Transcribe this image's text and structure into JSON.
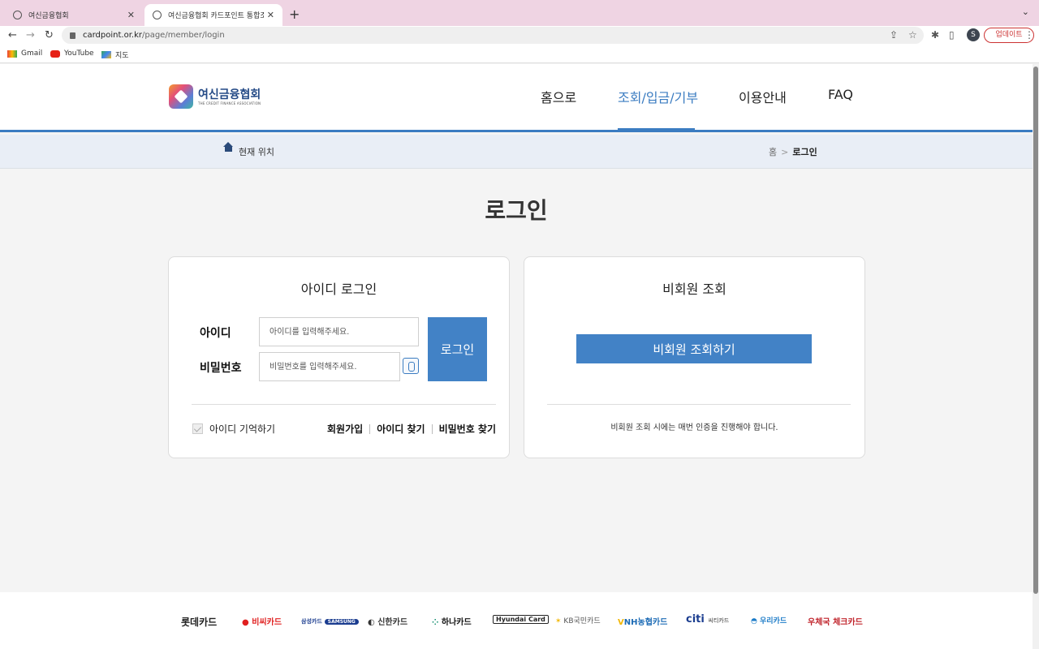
{
  "browser": {
    "tabs": [
      {
        "title": "여신금융협회"
      },
      {
        "title": "여신금융협회 카드포인트 통합조회 시"
      }
    ],
    "url_host": "cardpoint.or.kr",
    "url_path": "/page/member/login",
    "profile_initial": "S",
    "update_label": "업데이트",
    "bookmarks": [
      {
        "label": "Gmail",
        "icon": "gmail-icon"
      },
      {
        "label": "YouTube",
        "icon": "youtube-icon"
      },
      {
        "label": "지도",
        "icon": "maps-icon"
      }
    ]
  },
  "site": {
    "logo_ko": "여신금융협회",
    "logo_en": "THE CREDIT FINANCE ASSOCIATION",
    "nav": [
      {
        "label": "홈으로"
      },
      {
        "label": "조회/입금/기부"
      },
      {
        "label": "이용안내"
      },
      {
        "label": "FAQ"
      }
    ],
    "accent_color": "#3b7cc1"
  },
  "breadcrumb": {
    "label": "현재 위치",
    "home": "홈",
    "current": "로그인"
  },
  "page_title": "로그인",
  "login_panel": {
    "title": "아이디 로그인",
    "id_label": "아이디",
    "id_placeholder": "아이디를 입력해주세요.",
    "pw_label": "비밀번호",
    "pw_placeholder": "비밀번호를 입력해주세요.",
    "submit_label": "로그인",
    "remember_label": "아이디 기억하기",
    "links": [
      "회원가입",
      "아이디 찾기",
      "비밀번호 찾기"
    ]
  },
  "guest_panel": {
    "title": "비회원 조회",
    "button_label": "비회원 조회하기",
    "note": "비회원 조회 시에는 매번 인증을 진행해야 합니다."
  },
  "footer_cards": [
    "롯데카드",
    "비씨카드",
    "삼성카드",
    "SAMSUNG",
    "신한카드",
    "하나카드",
    "Hyundai Card",
    "KB국민카드",
    "NH농협카드",
    "citi",
    "씨티카드",
    "우리카드",
    "우체국 체크카드"
  ]
}
